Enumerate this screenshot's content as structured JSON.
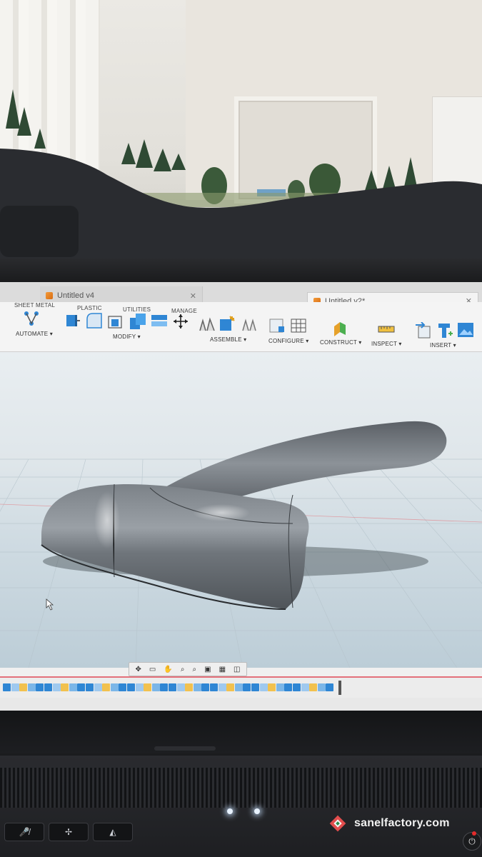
{
  "tabs": [
    {
      "label": "Untitled v4",
      "close": "✕"
    },
    {
      "label": "Untitled v2*",
      "close": "✕"
    }
  ],
  "toolbar": {
    "section_tabs": [
      "SHEET METAL",
      "PLASTIC",
      "UTILITIES",
      "MANAGE"
    ],
    "groups": [
      "AUTOMATE ▾",
      "MODIFY ▾",
      "ASSEMBLE ▾",
      "CONFIGURE ▾",
      "CONSTRUCT ▾",
      "INSPECT ▾",
      "INSERT ▾"
    ]
  },
  "watermark": {
    "text": "sanelfactory.com"
  },
  "colors": {
    "tab_icon": "#e0791d",
    "timeline_accent": "#e4707a",
    "icon_blue": "#2f86d4"
  }
}
